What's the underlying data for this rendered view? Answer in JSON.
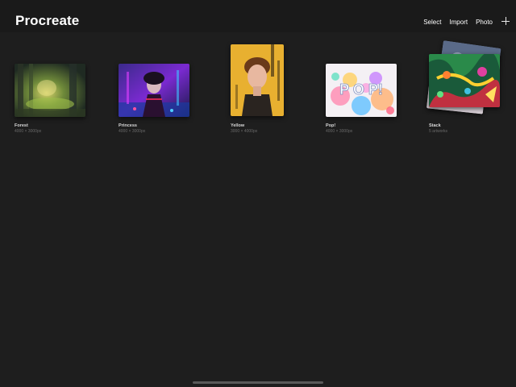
{
  "app": {
    "title": "Procreate"
  },
  "toolbar": {
    "select_label": "Select",
    "import_label": "Import",
    "photo_label": "Photo",
    "new_icon": "plus-icon"
  },
  "gallery": {
    "artworks": [
      {
        "title": "Forest",
        "size": "4000 × 3000px"
      },
      {
        "title": "Princess",
        "size": "4000 × 3000px"
      },
      {
        "title": "Yellow",
        "size": "3000 × 4000px"
      },
      {
        "title": "Pop!",
        "size": "4000 × 3000px"
      },
      {
        "title": "Stack",
        "size": "5 artworks"
      }
    ]
  },
  "colors": {
    "background": "#1e1e1e",
    "topbar": "#1a1a1a",
    "text": "#ffffff",
    "muted_text": "#6a6a6a"
  }
}
